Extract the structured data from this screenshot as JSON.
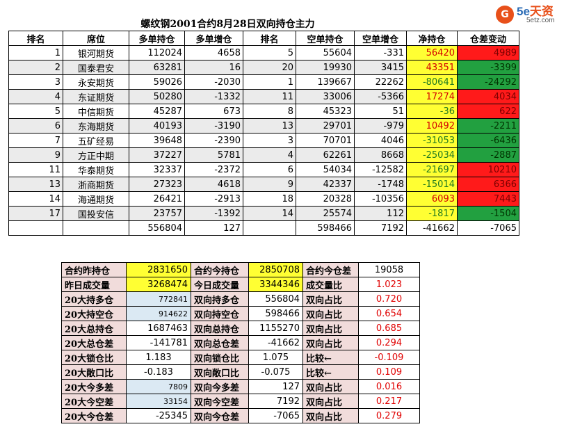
{
  "title": "螺纹钢2001合约8月28日双向持仓主力",
  "logo": {
    "mark": "G",
    "main_latin": "5e",
    "main_cn": "天资",
    "sub": "5etz.com"
  },
  "headers": [
    "排名",
    "席位",
    "多单持仓",
    "多单增仓",
    "排名",
    "空单持仓",
    "空单增仓",
    "净持仓",
    "仓差变动"
  ],
  "rows": [
    [
      "1",
      "银河期货",
      "112024",
      "4658",
      "5",
      "55604",
      "-331",
      "56420",
      "4989"
    ],
    [
      "2",
      "国泰君安",
      "63281",
      "16",
      "20",
      "19930",
      "3415",
      "43351",
      "-3399"
    ],
    [
      "3",
      "永安期货",
      "59026",
      "-2030",
      "1",
      "139667",
      "22262",
      "-80641",
      "-24292"
    ],
    [
      "4",
      "东证期货",
      "50280",
      "-1332",
      "11",
      "33006",
      "-5366",
      "17274",
      "4034"
    ],
    [
      "5",
      "中信期货",
      "45287",
      "673",
      "8",
      "45323",
      "51",
      "-36",
      "622"
    ],
    [
      "6",
      "东海期货",
      "40193",
      "-3190",
      "13",
      "29701",
      "-979",
      "10492",
      "-2211"
    ],
    [
      "7",
      "五矿经易",
      "39648",
      "-2390",
      "3",
      "70701",
      "4046",
      "-31053",
      "-6436"
    ],
    [
      "9",
      "方正中期",
      "37227",
      "5781",
      "4",
      "62261",
      "8668",
      "-25034",
      "-2887"
    ],
    [
      "11",
      "华泰期货",
      "32337",
      "-2372",
      "6",
      "54034",
      "-12582",
      "-21697",
      "10210"
    ],
    [
      "13",
      "浙商期货",
      "27323",
      "4618",
      "9",
      "42337",
      "-1748",
      "-15014",
      "6366"
    ],
    [
      "14",
      "海通期货",
      "26421",
      "-2913",
      "18",
      "20328",
      "-10356",
      "6093",
      "7443"
    ],
    [
      "17",
      "国投安信",
      "23757",
      "-1392",
      "14",
      "25574",
      "112",
      "-1817",
      "-1504"
    ]
  ],
  "totals": [
    "",
    "",
    "556804",
    "127",
    "",
    "598466",
    "7192",
    "-41662",
    "-7065"
  ],
  "summary": [
    [
      "合约昨持仓",
      "2831650",
      "合约今持仓",
      "2850708",
      "合约今仓差",
      "19058"
    ],
    [
      "昨日成交量",
      "3268474",
      "今日成交量",
      "3344346",
      "成交量比",
      "1.023"
    ],
    [
      "20大持多仓",
      "772841",
      "双向持多仓",
      "556804",
      "双向占比",
      "0.720"
    ],
    [
      "20大持空仓",
      "914622",
      "双向持空仓",
      "598466",
      "双向占比",
      "0.654"
    ],
    [
      "20大总持仓",
      "1687463",
      "双向总持仓",
      "1155270",
      "双向占比",
      "0.685"
    ],
    [
      "20大总仓差",
      "-141781",
      "双向总仓差",
      "-41662",
      "双向占比",
      "0.294"
    ],
    [
      "20大锁仓比",
      "1.183",
      "双向锁仓比",
      "1.075",
      "比较←",
      "-0.109"
    ],
    [
      "20大敞口比",
      "-0.183",
      "双向敞口比",
      "-0.075",
      "比较←",
      "0.109"
    ],
    [
      "20大今多差",
      "7809",
      "双向今多差",
      "127",
      "双向占比",
      "0.016"
    ],
    [
      "20大今空差",
      "33154",
      "双向今空差",
      "7192",
      "双向占比",
      "0.217"
    ],
    [
      "20大今仓差",
      "-25345",
      "双向今仓差",
      "-7065",
      "双向占比",
      "0.279"
    ]
  ],
  "colors": {
    "yellow": "#ffff33",
    "red": "#ff1a1a",
    "green": "#22a040",
    "label_pink": "#f1dcdb",
    "light_blue": "#dbe9f3"
  }
}
